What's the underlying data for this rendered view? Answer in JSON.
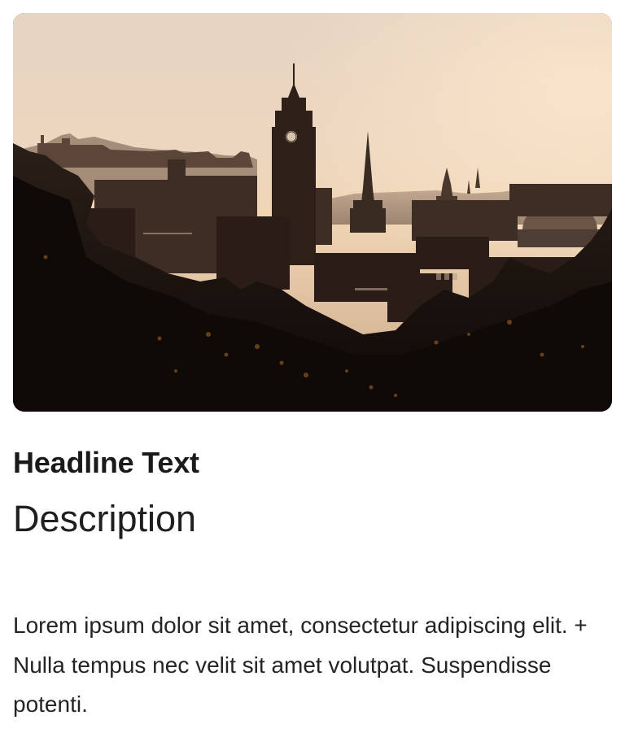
{
  "card": {
    "image_alt": "City skyline at sunset with clock tower and spires",
    "headline": "Headline Text",
    "description": "Description",
    "body": "Lorem ipsum dolor sit amet, consectetur adipiscing elit. + Nulla tempus nec velit sit amet volutpat. Suspendisse potenti."
  },
  "colors": {
    "sky_top": "#e9d6c3",
    "sky_horizon": "#f2d8bb",
    "silhouette": "#2a1e18",
    "foliage": "#120c08",
    "text": "#1a1a1a"
  }
}
